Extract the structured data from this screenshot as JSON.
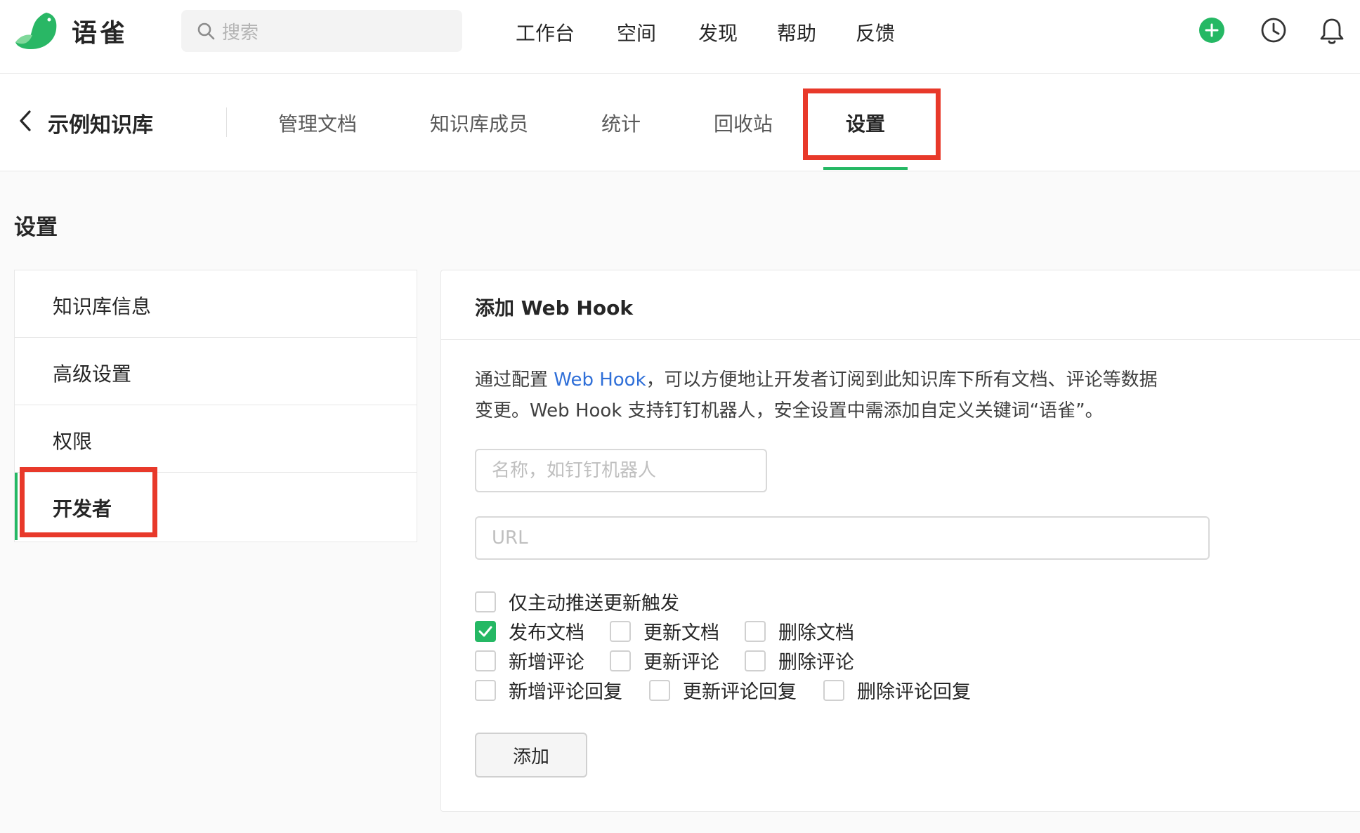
{
  "app": {
    "name": "语雀",
    "brand_color": "#25b864",
    "highlight_color": "#e8392a",
    "link_color": "#2f6fd8"
  },
  "search": {
    "placeholder": "搜索",
    "icon": "search-icon"
  },
  "topnav": {
    "items": [
      "工作台",
      "空间",
      "发现",
      "帮助",
      "反馈"
    ]
  },
  "top_icons": [
    "plus-circle-icon",
    "clock-icon",
    "bell-icon"
  ],
  "repo": {
    "title": "示例知识库",
    "back_icon": "chevron-left-icon"
  },
  "tabs": [
    {
      "label": "管理文档"
    },
    {
      "label": "知识库成员"
    },
    {
      "label": "统计"
    },
    {
      "label": "回收站"
    },
    {
      "label": "设置",
      "active": true
    }
  ],
  "page": {
    "heading": "设置"
  },
  "settings_menu": {
    "items": [
      {
        "label": "知识库信息"
      },
      {
        "label": "高级设置"
      },
      {
        "label": "权限"
      },
      {
        "label": "开发者",
        "active": true
      }
    ]
  },
  "webhook": {
    "title": "添加 Web Hook",
    "desc_prefix": "通过配置 ",
    "desc_link": "Web Hook",
    "desc_line1_rest": "，可以方便地让开发者订阅到此知识库下所有文档、评论等数据",
    "desc_line2": "变更。Web Hook 支持钉钉机器人，安全设置中需添加自定义关键词“语雀”。",
    "name_placeholder": "名称，如钉钉机器人",
    "url_placeholder": "URL",
    "checkboxes": {
      "only_active_push": {
        "label": "仅主动推送更新触发",
        "checked": false
      },
      "publish_doc": {
        "label": "发布文档",
        "checked": true
      },
      "update_doc": {
        "label": "更新文档",
        "checked": false
      },
      "delete_doc": {
        "label": "删除文档",
        "checked": false
      },
      "add_comment": {
        "label": "新增评论",
        "checked": false
      },
      "update_comment": {
        "label": "更新评论",
        "checked": false
      },
      "delete_comment": {
        "label": "删除评论",
        "checked": false
      },
      "add_reply": {
        "label": "新增评论回复",
        "checked": false
      },
      "update_reply": {
        "label": "更新评论回复",
        "checked": false
      },
      "delete_reply": {
        "label": "删除评论回复",
        "checked": false
      }
    },
    "add_button": "添加"
  }
}
